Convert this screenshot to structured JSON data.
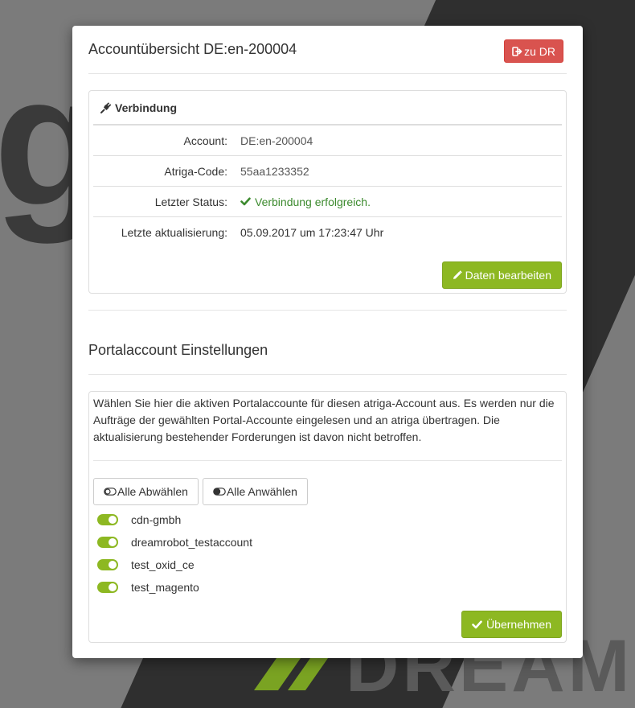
{
  "background": {
    "letter": "ga",
    "bottom_text": "DREAM"
  },
  "modal": {
    "title": "Accountübersicht DE:en-200004",
    "back_button_label": "zu DR"
  },
  "connection_panel": {
    "heading": "Verbindung",
    "rows": [
      {
        "label": "Account:",
        "value": "DE:en-200004"
      },
      {
        "label": "Atriga-Code:",
        "value": "55aa1233352"
      },
      {
        "label": "Letzter Status:",
        "value": "Verbindung erfolgreich."
      },
      {
        "label": "Letzte aktualisierung:",
        "value": "05.09.2017 um 17:23:47 Uhr"
      }
    ],
    "edit_button_label": "Daten bearbeiten"
  },
  "portal_settings": {
    "title": "Portalaccount Einstellungen",
    "description": "Wählen Sie hier die aktiven Portalaccounte für diesen atriga-Account aus. Es werden nur die Aufträge der gewählten Portal-Accounte eingelesen und an atriga übertragen. Die aktualisierung bestehender Forderungen ist davon nicht betroffen.",
    "deselect_all_label": "Alle Abwählen",
    "select_all_label": "Alle Anwählen",
    "accounts": [
      {
        "name": "cdn-gmbh",
        "enabled": true
      },
      {
        "name": "dreamrobot_testaccount",
        "enabled": true
      },
      {
        "name": "test_oxid_ce",
        "enabled": true
      },
      {
        "name": "test_magento",
        "enabled": true
      }
    ],
    "apply_button_label": "Übernehmen"
  },
  "colors": {
    "danger": "#d9534f",
    "success": "#8db822",
    "status_ok_text": "#3c8a2e"
  },
  "icons": {
    "back": "sign-out-icon",
    "connection": "plug-icon",
    "status": "check-icon",
    "edit": "pencil-icon",
    "toggle_off": "toggle-off-icon",
    "toggle_on": "toggle-on-icon",
    "apply": "check-icon"
  }
}
